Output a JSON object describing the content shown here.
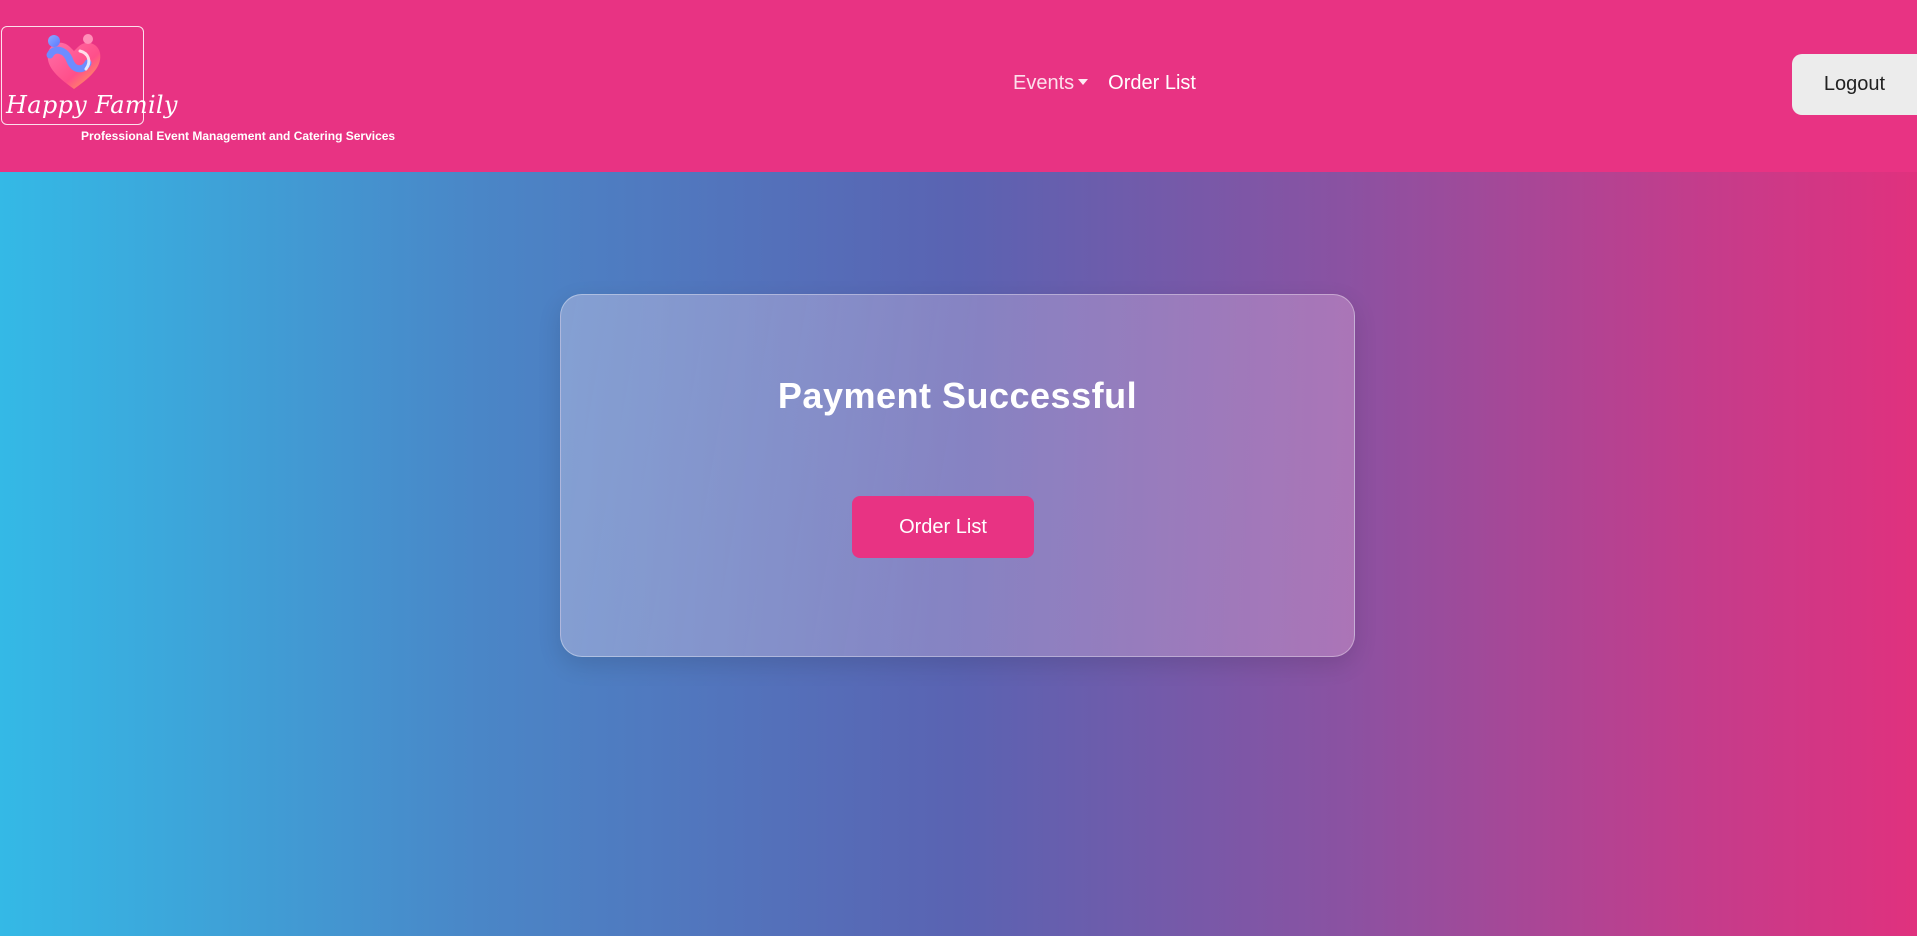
{
  "brand": {
    "logo_text": "Happy Family",
    "tagline": "Professional Event Management and Catering Services",
    "icon": "heart-family-icon"
  },
  "nav": {
    "events_label": "Events",
    "order_list_label": "Order List",
    "logout_label": "Logout"
  },
  "card": {
    "title": "Payment Successful",
    "button_label": "Order List"
  },
  "colors": {
    "primary": "#e83383",
    "logout_bg": "#ececec",
    "gradient_start": "#34b9e6",
    "gradient_mid": "#5a63b2",
    "gradient_end": "#e0317e"
  }
}
